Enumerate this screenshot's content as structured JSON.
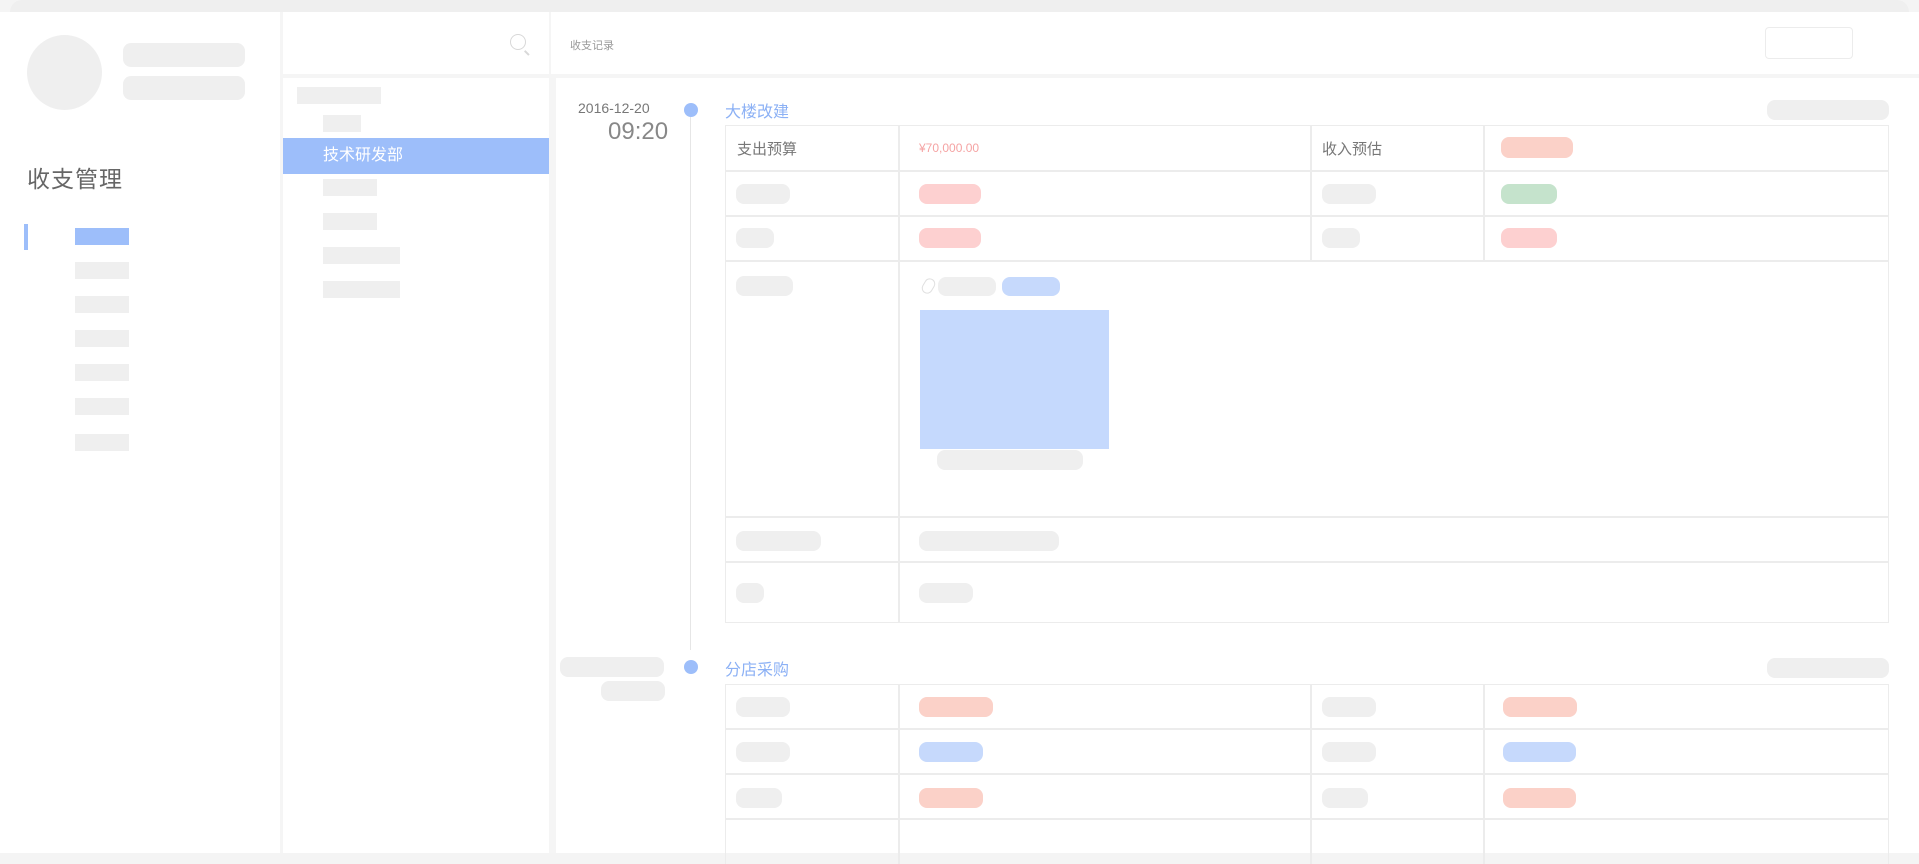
{
  "app": {
    "brand_title": "收支管理",
    "breadcrumb": "收支记录"
  },
  "departments": {
    "active": "技术研发部"
  },
  "records": [
    {
      "date": "2016-12-20",
      "time": "09:20",
      "title": "大楼改建",
      "labels": {
        "expense_budget": "支出预算",
        "income_estimate": "收入预估"
      },
      "expense_amount": "¥70,000.00"
    },
    {
      "title": "分店采购"
    }
  ],
  "icons": {
    "search": "search-icon",
    "attachment": "paperclip-icon"
  },
  "colors": {
    "accent": "#9dbefa",
    "title_blue": "#8cb1f5",
    "money_red": "#f5a3a3"
  }
}
